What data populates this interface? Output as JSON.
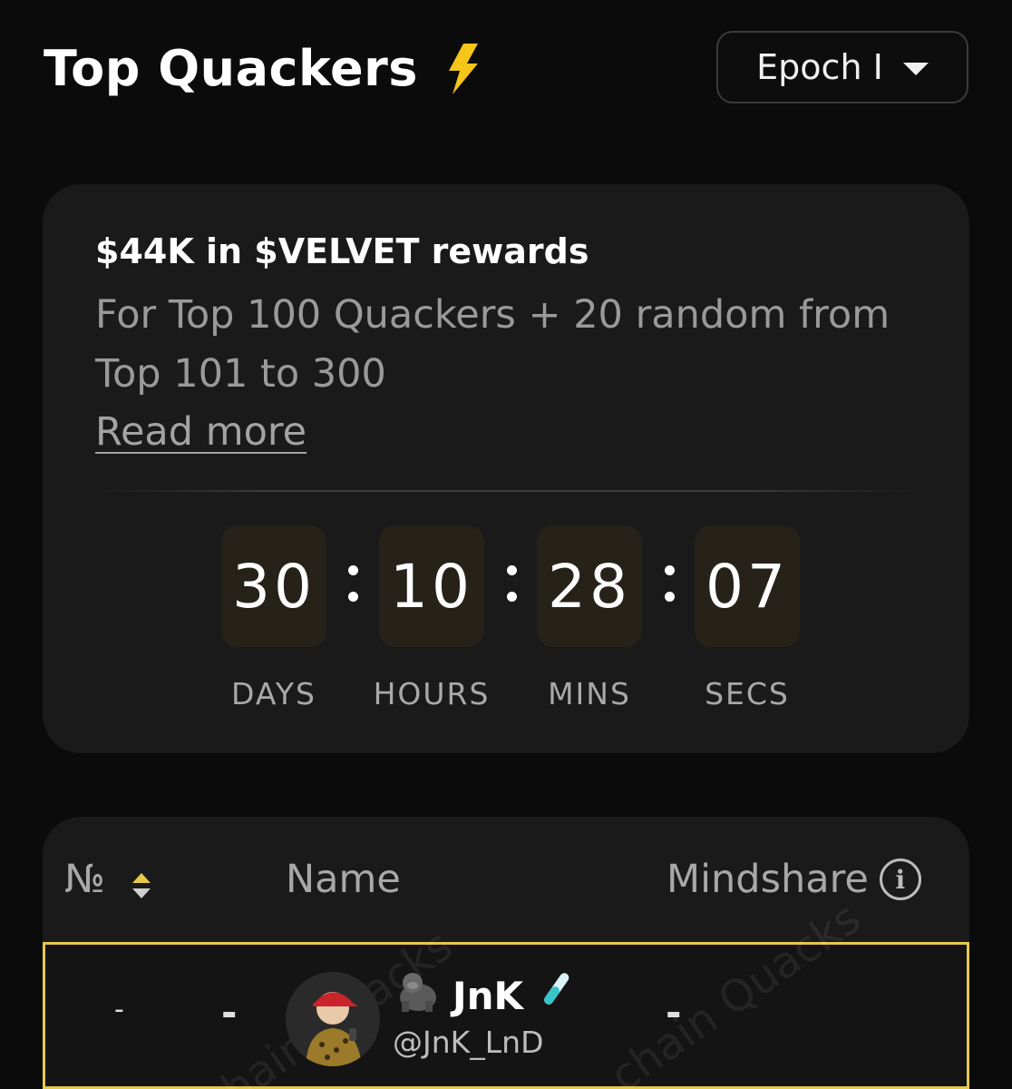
{
  "header": {
    "title": "Top Quackers",
    "title_icon": "lightning-bolt-icon",
    "epoch_select": {
      "value": "Epoch I",
      "icon": "chevron-down-icon"
    }
  },
  "rewards": {
    "title": "$44K in $VELVET rewards",
    "description": "For Top 100 Quackers + 20 random from Top 101 to 300",
    "read_more": "Read more"
  },
  "countdown": {
    "days": "30",
    "hours": "10",
    "mins": "28",
    "secs": "07",
    "labels": {
      "days": "DAYS",
      "hours": "HOURS",
      "mins": "MINS",
      "secs": "SECS"
    }
  },
  "table": {
    "headers": {
      "rank": "№",
      "name": "Name",
      "mindshare": "Mindshare"
    },
    "rows": [
      {
        "rank": "-",
        "change": "-",
        "name": "JnK",
        "name_prefix_icon": "gorilla-icon",
        "name_suffix_icon": "test-tube-icon",
        "handle": "@JnK_LnD",
        "mindshare": "-"
      }
    ],
    "watermark": "chain Quacks"
  },
  "colors": {
    "background": "#0b0b0b",
    "card": "#1a1a1a",
    "accent": "#e7c94a",
    "bolt": "#f5c518",
    "countdown_box": "#26221a"
  }
}
